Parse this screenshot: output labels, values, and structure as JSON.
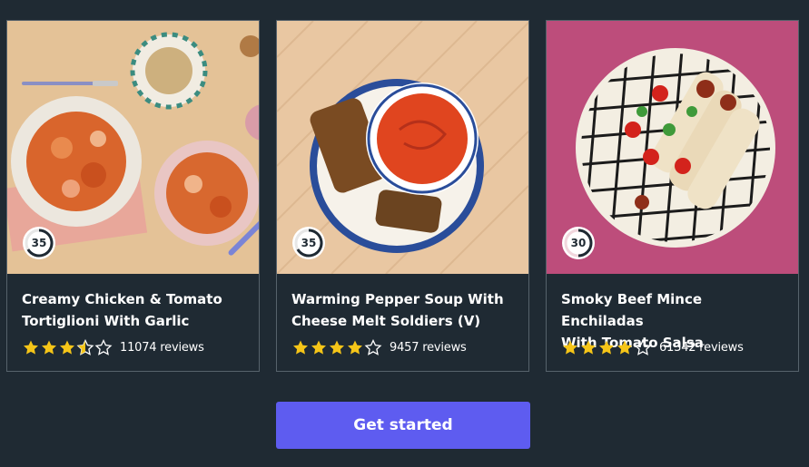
{
  "cards": [
    {
      "time": "35",
      "title_line1": "Creamy Chicken & Tomato",
      "title_line2": "Tortiglioni With Garlic",
      "rating": 3.5,
      "reviews": "11074 reviews",
      "image_icon": "pasta-dish-photo"
    },
    {
      "time": "35",
      "title_line1": "Warming Pepper Soup With",
      "title_line2": "Cheese Melt Soldiers (V)",
      "rating": 4,
      "reviews": "9457 reviews",
      "image_icon": "soup-dish-photo"
    },
    {
      "time": "30",
      "title_line1": "Smoky Beef Mince Enchiladas",
      "title_line2": "With Tomato Salsa",
      "rating": 4,
      "reviews": "61342 reviews",
      "image_icon": "enchilada-dish-photo"
    }
  ],
  "cta": {
    "label": "Get started"
  },
  "colors": {
    "background": "#1f2a33",
    "star": "#f5c518",
    "cta": "#5e5cf0",
    "card_border": "#56626b"
  }
}
